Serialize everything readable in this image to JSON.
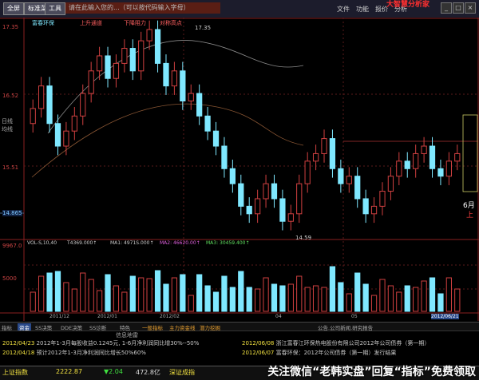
{
  "menu": {
    "buttons": [
      "全屏",
      "标准菜单",
      "工具"
    ],
    "search_text": "请在此输入您的...（可以按代码输入字母）",
    "items": [
      "文件",
      "功能",
      "报价",
      "分析"
    ],
    "brand": "大智慧分析家"
  },
  "chart": {
    "title": "富春环保",
    "legend_up": "上升通道",
    "legend_down": "下降阻力",
    "legend_high": "对称高点",
    "high_label": "17.35",
    "low_label": "14.59",
    "current_price": "14.865",
    "right_label": "6月",
    "right_sub": "上",
    "price_ticks": [
      "17.35",
      "16.52",
      "15.51"
    ],
    "side_labels": [
      "日线",
      "均线"
    ],
    "vol_ticks": [
      "9967.0",
      "5000",
      "0"
    ],
    "vol_legend": [
      "VOL-S,10,40",
      "T4369.000↑",
      "MA1: 4971S.000↑",
      "MA2: 46620.00↑",
      "MA3: 30459.400↑"
    ],
    "dates": [
      "2011/12",
      "2012/01",
      "2012/02",
      "04",
      "05",
      "2012/06/21"
    ]
  },
  "chart_data": {
    "type": "candlestick",
    "title": "富春环保",
    "price_range": [
      14.59,
      17.35
    ],
    "series": [
      {
        "name": "K线",
        "values": [
          16.3,
          16.6,
          16.1,
          15.8,
          16.0,
          16.2,
          16.5,
          16.8,
          17.0,
          16.7,
          16.9,
          17.1,
          16.8,
          17.2,
          17.35,
          16.9,
          16.6,
          16.8,
          16.4,
          16.5,
          16.2,
          16.0,
          15.8,
          15.5,
          15.3,
          15.0,
          14.9,
          15.1,
          15.3,
          15.1,
          14.8,
          14.9,
          15.3,
          15.6,
          15.7,
          15.9,
          15.5,
          15.3,
          15.4,
          15.1,
          14.9,
          15.0,
          15.2,
          15.4,
          15.6,
          15.5,
          15.7,
          15.8,
          15.5,
          15.4,
          15.6,
          15.7
        ]
      }
    ]
  },
  "tabs": [
    {
      "label": "指标",
      "active": false
    },
    {
      "label": "资金",
      "active": true
    },
    {
      "label": "SS决策",
      "active": false
    },
    {
      "label": "DDE决策",
      "active": false
    },
    {
      "label": "SS诊断",
      "active": false
    },
    {
      "label": "特色",
      "active": false
    },
    {
      "label": "一般指标",
      "active": false
    },
    {
      "label": "主力资金线",
      "active": false
    },
    {
      "label": "潜力挖掘",
      "active": false
    },
    {
      "label": "公告.公司新闻.研究报告",
      "active": false
    }
  ],
  "news": {
    "header": "信息地雷",
    "rows": [
      {
        "date": "2012/04/23",
        "text": "2012年1-3月每股收益0.1245元, 1-6月净利润同比增30%--50%"
      },
      {
        "date": "2012/04/18",
        "text": "预计2012年1-3月净利润同比增长50%60%"
      },
      {
        "date": "2012/06/08",
        "text": "浙江富春江环保热电股份有限公司2012年公司债券（第一期）"
      },
      {
        "date": "2012/06/07",
        "text": "富春环保：2012年公司债券（第一期）发行结果"
      }
    ]
  },
  "status": {
    "index1_name": "上证指数",
    "index1_value": "2222.87",
    "index1_change": "▼2.04",
    "amount": "472.8亿",
    "index2_name": "深证成指",
    "watermark": "关注微信“老韩实盘”回复“指标”免费领取"
  }
}
